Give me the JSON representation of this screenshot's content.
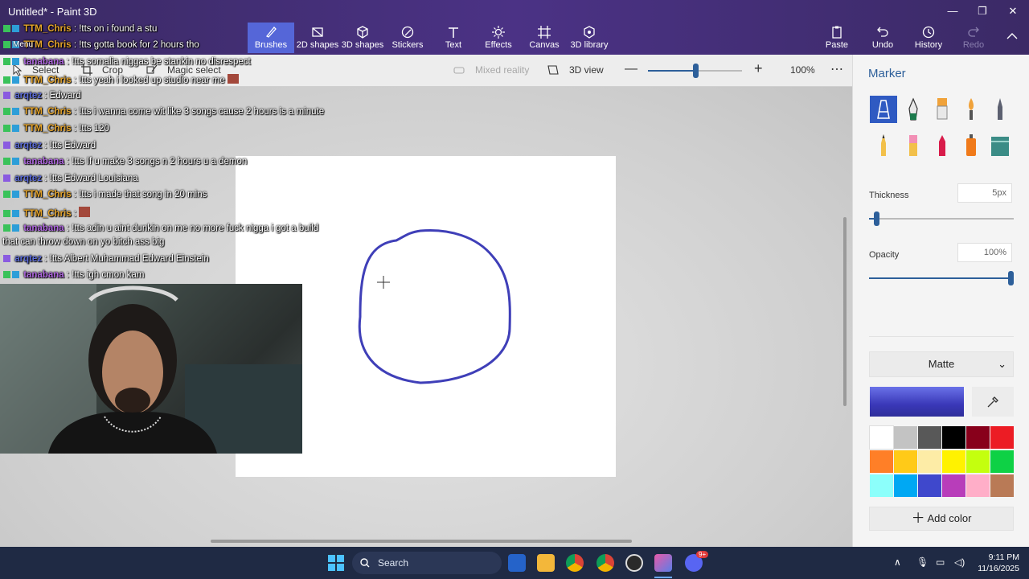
{
  "window": {
    "title": "Untitled* - Paint 3D",
    "controls": [
      "—",
      "❐",
      "✕"
    ]
  },
  "ribbon": {
    "tools": [
      {
        "label": "Brushes",
        "icon": "brush-icon"
      },
      {
        "label": "2D shapes",
        "icon": "2d-shapes-icon"
      },
      {
        "label": "3D shapes",
        "icon": "3d-shapes-icon"
      },
      {
        "label": "Stickers",
        "icon": "stickers-icon"
      },
      {
        "label": "Text",
        "icon": "text-icon"
      },
      {
        "label": "Effects",
        "icon": "effects-icon"
      },
      {
        "label": "Canvas",
        "icon": "canvas-icon"
      },
      {
        "label": "3D library",
        "icon": "3d-library-icon"
      }
    ],
    "right": [
      {
        "label": "Paste",
        "icon": "paste-icon"
      },
      {
        "label": "Undo",
        "icon": "undo-icon"
      },
      {
        "label": "History",
        "icon": "history-icon"
      },
      {
        "label": "Redo",
        "icon": "redo-icon"
      }
    ],
    "menu_label": "Menu"
  },
  "toolbar": {
    "select": "Select",
    "crop": "Crop",
    "magic_select": "Magic select",
    "mixed_reality": "Mixed reality",
    "view_3d": "3D view",
    "zoom_level": 100,
    "zoom": "100%",
    "more": "⋯"
  },
  "chat": [
    {
      "user": "TTM_Chris",
      "color": "#e6a52c",
      "text": ": !tts on i found a stu"
    },
    {
      "user": "TTM_Chris",
      "color": "#e6a52c",
      "text": ": !tts gotta book for 2 hours tho"
    },
    {
      "user": "tanabana",
      "color": "#b068e0",
      "text": ": !tts somalia niggas be stankin no disrespect"
    },
    {
      "user": "TTM_Chris",
      "color": "#e6a52c",
      "text": ": !tts yeah i looked up studio near me"
    },
    {
      "user": "arqtez",
      "color": "#5b6bd8",
      "text": ": Edward"
    },
    {
      "user": "TTM_Chris",
      "color": "#e6a52c",
      "text": ": !tts i wanna come wit like 3 songs cause 2 hours is a minute"
    },
    {
      "user": "TTM_Chris",
      "color": "#e6a52c",
      "text": ": !tts 120"
    },
    {
      "user": "arqtez",
      "color": "#5b6bd8",
      "text": ": !tts Edward"
    },
    {
      "user": "tanabana",
      "color": "#b068e0",
      "text": ": !tts If u make 3 songs n 2 hours u a demon"
    },
    {
      "user": "arqtez",
      "color": "#5b6bd8",
      "text": ": !tts Edward Louisiana"
    },
    {
      "user": "TTM_Chris",
      "color": "#e6a52c",
      "text": ": !tts i made that song in 20 mins"
    },
    {
      "user": "TTM_Chris",
      "color": "#e6a52c",
      "text": ":"
    },
    {
      "user": "tanabana",
      "color": "#b068e0",
      "text": ": !tts adin u aint dunkin on me no more fuck nigga i got a build"
    },
    {
      "user": "",
      "color": "#ffffff",
      "text": "that can throw down on yo bitch ass big"
    },
    {
      "user": "arqtez",
      "color": "#5b6bd8",
      "text": ": !tts Albert Muhammad Edward Einstein"
    },
    {
      "user": "tanabana",
      "color": "#b068e0",
      "text": ": !tts igh cmon kam"
    }
  ],
  "panel": {
    "title": "Marker",
    "brushes": [
      "marker-brush-icon",
      "calligraphy-pen-icon",
      "oil-brush-icon",
      "watercolor-icon",
      "pixel-pen-icon",
      "pencil-icon",
      "eraser-icon",
      "crayon-icon",
      "spray-can-icon",
      "fill-icon"
    ],
    "thickness_label": "Thickness",
    "thickness_value": "5px",
    "thickness_fraction": 0.05,
    "opacity_label": "Opacity",
    "opacity_value": "100%",
    "opacity_fraction": 1.0,
    "finish": "Matte",
    "current_color": "#3a38b8",
    "palette": [
      "#ffffff",
      "#c3c3c3",
      "#585858",
      "#000000",
      "#88001b",
      "#ec1c24",
      "#ff7f27",
      "#ffca18",
      "#fdeca6",
      "#fff200",
      "#c4ff0e",
      "#0ed145",
      "#8cfffb",
      "#00a8f3",
      "#3f48cc",
      "#b83dba",
      "#ffaec8",
      "#b97a56"
    ],
    "add_color": "Add color"
  },
  "taskbar": {
    "search_placeholder": "Search",
    "time": "9:11 PM",
    "date": "11/16/2025",
    "discord_badge": "9+"
  }
}
